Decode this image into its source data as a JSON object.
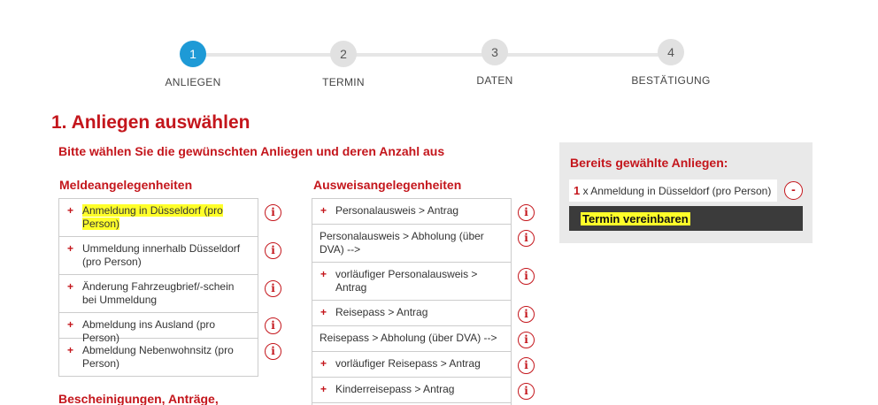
{
  "stepper": {
    "steps": [
      {
        "number": "1",
        "label": "ANLIEGEN"
      },
      {
        "number": "2",
        "label": "TERMIN"
      },
      {
        "number": "3",
        "label": "DATEN"
      },
      {
        "number": "4",
        "label": "BESTÄTIGUNG"
      }
    ]
  },
  "page": {
    "title": "1. Anliegen auswählen",
    "subtitle": "Bitte wählen Sie die gewünschten Anliegen und deren Anzahl aus"
  },
  "melde": {
    "title": "Meldeangelegenheiten",
    "items": [
      {
        "label": "Anmeldung in Düsseldorf (pro Person)"
      },
      {
        "label": "Ummeldung innerhalb Düsseldorf (pro Person)"
      },
      {
        "label": "Änderung Fahrzeugbrief/-schein bei Ummeldung"
      },
      {
        "label": "Abmeldung ins Ausland (pro Person)"
      },
      {
        "label": "Abmeldung Nebenwohnsitz (pro Person)"
      }
    ]
  },
  "ausweis": {
    "title": "Ausweisangelegenheiten",
    "items": [
      {
        "label": "Personalausweis > Antrag"
      },
      {
        "label": "Personalausweis > Abholung (über DVA) -->"
      },
      {
        "label": "vorläufiger Personalausweis > Antrag"
      },
      {
        "label": "Reisepass > Antrag"
      },
      {
        "label": "Reisepass > Abholung (über DVA) -->"
      },
      {
        "label": "vorläufiger Reisepass > Antrag"
      },
      {
        "label": "Kinderreisepass > Antrag"
      }
    ]
  },
  "bescheinigungen": {
    "title": "Bescheinigungen, Anträge,"
  },
  "icons": {
    "plus": "+",
    "info": "i",
    "minus": "-"
  },
  "selected": {
    "title": "Bereits gewählte Anliegen:",
    "count": "1",
    "text": "x Anmeldung in Düsseldorf (pro Person)",
    "cta": "Termin vereinbaren"
  },
  "colors": {
    "accent": "#c4161c",
    "active_step": "#1e9ad6",
    "highlight": "#ffff2a",
    "cta_bg": "#3b3b3b"
  }
}
